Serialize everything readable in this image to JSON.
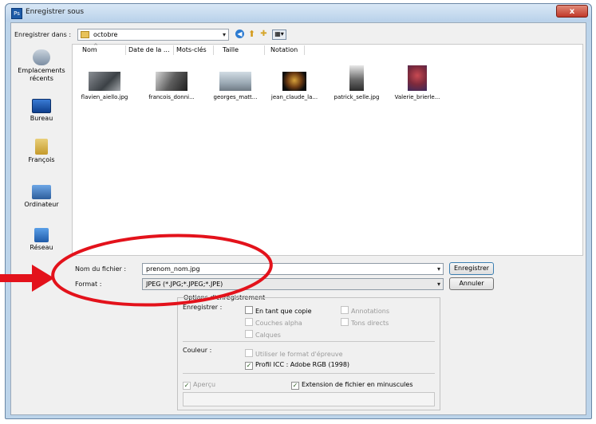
{
  "window": {
    "title": "Enregistrer sous",
    "close_label": "x"
  },
  "toolbar": {
    "location_label": "Enregistrer dans :",
    "location_value": "octobre"
  },
  "places": [
    {
      "label": "Emplacements récents"
    },
    {
      "label": "Bureau"
    },
    {
      "label": "François"
    },
    {
      "label": "Ordinateur"
    },
    {
      "label": "Réseau"
    }
  ],
  "columns": [
    "Nom",
    "Date de la ...",
    "Mots-clés",
    "Taille",
    "Notation"
  ],
  "files": [
    {
      "name": "flavien_aiello.jpg"
    },
    {
      "name": "francois_donni..."
    },
    {
      "name": "georges_matt..."
    },
    {
      "name": "jean_claude_la..."
    },
    {
      "name": "patrick_selle.jpg"
    },
    {
      "name": "Valerie_brierle..."
    }
  ],
  "form": {
    "filename_label": "Nom du fichier :",
    "filename_value": "prenom_nom.jpg",
    "format_label": "Format :",
    "format_value": "JPEG (*.JPG;*.JPEG;*.JPE)",
    "save_button": "Enregistrer",
    "cancel_button": "Annuler"
  },
  "options": {
    "title": "Options d'enregistrement",
    "save_label": "Enregistrer :",
    "as_copy": "En tant que copie",
    "annotations": "Annotations",
    "alpha": "Couches alpha",
    "spot": "Tons directs",
    "layers": "Calques",
    "color_label": "Couleur :",
    "proof": "Utiliser le format d'épreuve",
    "icc": "Profil ICC : Adobe RGB (1998)",
    "preview": "Aperçu",
    "extension": "Extension de fichier en minuscules"
  },
  "colors": {
    "annotation_red": "#e3121b",
    "title_bar": "#c6dcf1"
  }
}
